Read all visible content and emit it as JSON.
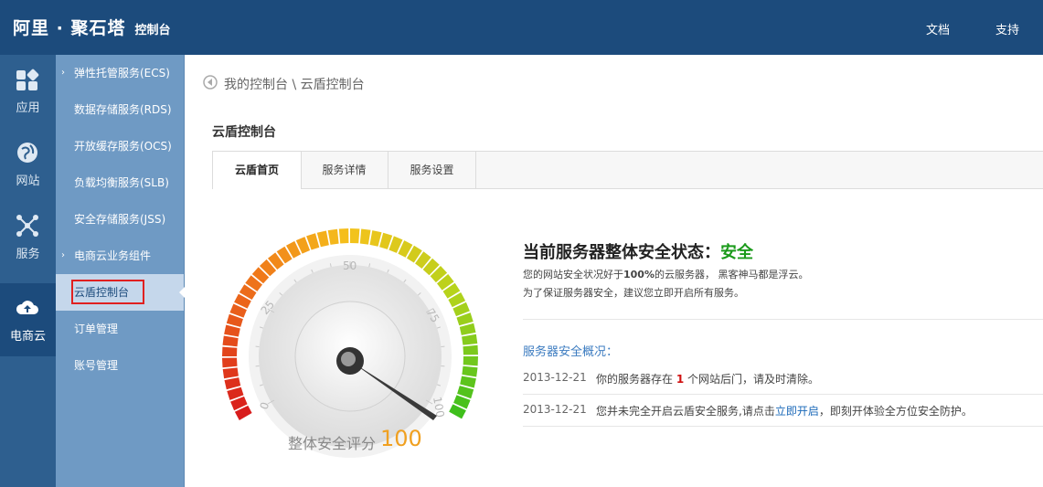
{
  "header": {
    "brand": "阿里 · 聚石塔",
    "brand_sub": "控制台",
    "links": [
      "文档",
      "支持"
    ]
  },
  "rail": [
    {
      "label": "应用",
      "icon": "apps-icon"
    },
    {
      "label": "网站",
      "icon": "globe-icon"
    },
    {
      "label": "服务",
      "icon": "network-icon"
    },
    {
      "label": "电商云",
      "icon": "cloud-upload-icon"
    }
  ],
  "subnav": [
    {
      "label": "弹性托管服务(ECS)",
      "chevron": true
    },
    {
      "label": "数据存储服务(RDS)",
      "chevron": false
    },
    {
      "label": "开放缓存服务(OCS)",
      "chevron": false
    },
    {
      "label": "负载均衡服务(SLB)",
      "chevron": false
    },
    {
      "label": "安全存储服务(JSS)",
      "chevron": false
    },
    {
      "label": "电商云业务组件",
      "chevron": true
    },
    {
      "label": "云盾控制台",
      "chevron": false
    },
    {
      "label": "订单管理",
      "chevron": false
    },
    {
      "label": "账号管理",
      "chevron": false
    }
  ],
  "breadcrumb": "我的控制台 \\ 云盾控制台",
  "page_title": "云盾控制台",
  "tabs": [
    "云盾首页",
    "服务详情",
    "服务设置"
  ],
  "gauge": {
    "ticks": [
      "0",
      "25",
      "50",
      "75",
      "100"
    ],
    "score_label": "整体安全评分",
    "score": "100",
    "score_color": "#f0a020"
  },
  "status": {
    "title": "当前服务器整体安全状态：",
    "state": "安全",
    "line1_pre": "您的网站安全状况好于",
    "line1_bold": "100%",
    "line1_post": "的云服务器， 黑客神马都是浮云。",
    "line2": "为了保证服务器安全，建议您立即开启所有服务。"
  },
  "overview": {
    "title": "服务器安全概况：",
    "rows": [
      {
        "date": "2013-12-21",
        "pre": "你的服务器存在 ",
        "red": "1",
        "post": " 个网站后门，请及时清除。"
      },
      {
        "date": "2013-12-21",
        "pre": "您并未完全开启云盾安全服务,请点击",
        "link": "立即开启",
        "post": "，即刻开体验全方位安全防护。"
      }
    ]
  },
  "colors": {
    "header_bg": "#1c4b7c",
    "rail_bg": "#2e5f8f",
    "subnav_bg": "#6f9ac4",
    "safe_green": "#1a9a1a",
    "link_blue": "#3b7bc0"
  }
}
